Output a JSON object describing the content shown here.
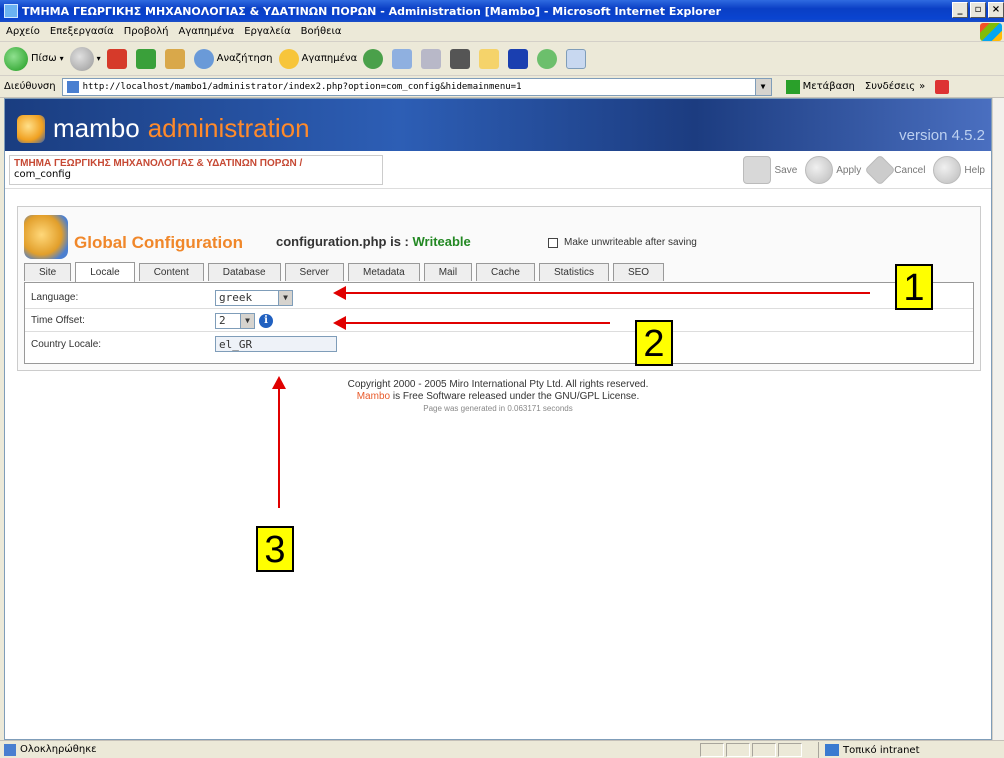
{
  "window": {
    "title": "ΤΜΗΜΑ ΓΕΩΡΓΙΚΗΣ ΜΗΧΑΝΟΛΟΓΙΑΣ & ΥΔΑΤΙΝΩΝ ΠΟΡΩΝ - Administration [Mambo] - Microsoft Internet Explorer",
    "minimize": "_",
    "maximize": "▫",
    "close": "×"
  },
  "menu": [
    "Αρχείο",
    "Επεξεργασία",
    "Προβολή",
    "Αγαπημένα",
    "Εργαλεία",
    "Βοήθεια"
  ],
  "toolbar": {
    "back": "Πίσω",
    "search": "Αναζήτηση",
    "favorites": "Αγαπημένα"
  },
  "address": {
    "label": "Διεύθυνση",
    "url": "http://localhost/mambo1/administrator/index2.php?option=com_config&hidemainmenu=1",
    "go": "Μετάβαση",
    "links": "Συνδέσεις",
    "links_more": "»"
  },
  "header": {
    "logo_mambo": "mambo",
    "logo_admin": "administration",
    "version": "version 4.5.2"
  },
  "pathway": {
    "site_name": "ΤΜΗΜΑ ΓΕΩΡΓΙΚΗΣ ΜΗΧΑΝΟΛΟΓΙΑΣ & ΥΔΑΤΙΝΩΝ ΠΟΡΩΝ /",
    "component": "com_config"
  },
  "actions": {
    "save": "Save",
    "apply": "Apply",
    "cancel": "Cancel",
    "help": "Help"
  },
  "config": {
    "title": "Global Configuration",
    "status_prefix": "configuration.php is : ",
    "status_value": "Writeable",
    "make_unwriteable": "Make unwriteable after saving"
  },
  "tabs": [
    "Site",
    "Locale",
    "Content",
    "Database",
    "Server",
    "Metadata",
    "Mail",
    "Cache",
    "Statistics",
    "SEO"
  ],
  "locale": {
    "language_label": "Language:",
    "language_value": "greek",
    "offset_label": "Time Offset:",
    "offset_value": "2",
    "country_label": "Country Locale:",
    "country_value": "el_GR"
  },
  "footer": {
    "copyright": "Copyright 2000 - 2005 Miro International Pty Ltd. All rights reserved.",
    "mambo": "Mambo",
    "license": " is Free Software released under the GNU/GPL License.",
    "generated": "Page was generated in 0.063171 seconds"
  },
  "callouts": [
    "1",
    "2",
    "3"
  ],
  "status": {
    "done": "Ολοκληρώθηκε",
    "zone": "Τοπικό intranet"
  },
  "colors": {
    "accent_orange": "#f0872a",
    "writeable_green": "#228822",
    "callout_yellow": "#ffff00",
    "arrow_red": "#e00000"
  }
}
